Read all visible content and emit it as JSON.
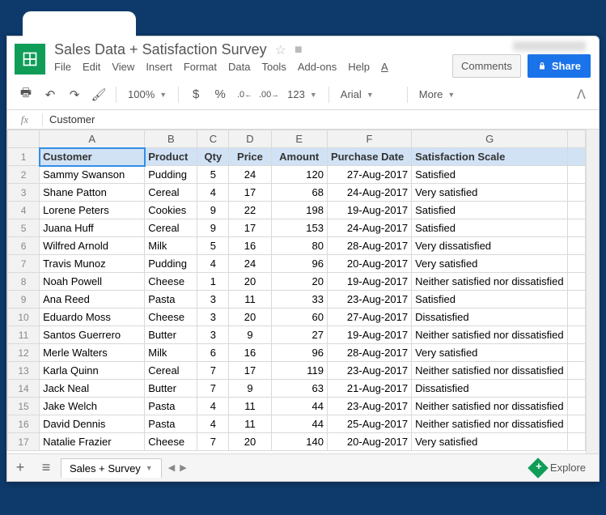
{
  "doc_title": "Sales Data + Satisfaction Survey",
  "menu": {
    "file": "File",
    "edit": "Edit",
    "view": "View",
    "insert": "Insert",
    "format": "Format",
    "data": "Data",
    "tools": "Tools",
    "addons": "Add-ons",
    "help": "Help",
    "last_edit": "A"
  },
  "buttons": {
    "comments": "Comments",
    "share": "Share"
  },
  "toolbar": {
    "zoom": "100%",
    "currency": "$",
    "percent": "%",
    "dec_dec": ".0",
    "dec_inc": ".00",
    "numfmt": "123",
    "font": "Arial",
    "more": "More"
  },
  "formula_bar": {
    "fx": "fx",
    "value": "Customer"
  },
  "columns": [
    "A",
    "B",
    "C",
    "D",
    "E",
    "F",
    "G",
    ""
  ],
  "header_row": {
    "A": "Customer",
    "B": "Product",
    "C": "Qty",
    "D": "Price",
    "E": "Amount",
    "F": "Purchase Date",
    "G": "Satisfaction Scale"
  },
  "rows": [
    {
      "n": 2,
      "A": "Sammy Swanson",
      "B": "Pudding",
      "C": 5,
      "D": 24,
      "E": 120,
      "F": "27-Aug-2017",
      "G": "Satisfied"
    },
    {
      "n": 3,
      "A": "Shane Patton",
      "B": "Cereal",
      "C": 4,
      "D": 17,
      "E": 68,
      "F": "24-Aug-2017",
      "G": "Very satisfied"
    },
    {
      "n": 4,
      "A": "Lorene Peters",
      "B": "Cookies",
      "C": 9,
      "D": 22,
      "E": 198,
      "F": "19-Aug-2017",
      "G": "Satisfied"
    },
    {
      "n": 5,
      "A": "Juana Huff",
      "B": "Cereal",
      "C": 9,
      "D": 17,
      "E": 153,
      "F": "24-Aug-2017",
      "G": "Satisfied"
    },
    {
      "n": 6,
      "A": "Wilfred Arnold",
      "B": "Milk",
      "C": 5,
      "D": 16,
      "E": 80,
      "F": "28-Aug-2017",
      "G": "Very dissatisfied"
    },
    {
      "n": 7,
      "A": "Travis Munoz",
      "B": "Pudding",
      "C": 4,
      "D": 24,
      "E": 96,
      "F": "20-Aug-2017",
      "G": "Very satisfied"
    },
    {
      "n": 8,
      "A": "Noah Powell",
      "B": "Cheese",
      "C": 1,
      "D": 20,
      "E": 20,
      "F": "19-Aug-2017",
      "G": "Neither satisfied nor dissatisfied"
    },
    {
      "n": 9,
      "A": "Ana Reed",
      "B": "Pasta",
      "C": 3,
      "D": 11,
      "E": 33,
      "F": "23-Aug-2017",
      "G": "Satisfied"
    },
    {
      "n": 10,
      "A": "Eduardo Moss",
      "B": "Cheese",
      "C": 3,
      "D": 20,
      "E": 60,
      "F": "27-Aug-2017",
      "G": "Dissatisfied"
    },
    {
      "n": 11,
      "A": "Santos Guerrero",
      "B": "Butter",
      "C": 3,
      "D": 9,
      "E": 27,
      "F": "19-Aug-2017",
      "G": "Neither satisfied nor dissatisfied"
    },
    {
      "n": 12,
      "A": "Merle Walters",
      "B": "Milk",
      "C": 6,
      "D": 16,
      "E": 96,
      "F": "28-Aug-2017",
      "G": "Very satisfied"
    },
    {
      "n": 13,
      "A": "Karla Quinn",
      "B": "Cereal",
      "C": 7,
      "D": 17,
      "E": 119,
      "F": "23-Aug-2017",
      "G": "Neither satisfied nor dissatisfied"
    },
    {
      "n": 14,
      "A": "Jack Neal",
      "B": "Butter",
      "C": 7,
      "D": 9,
      "E": 63,
      "F": "21-Aug-2017",
      "G": "Dissatisfied"
    },
    {
      "n": 15,
      "A": "Jake Welch",
      "B": "Pasta",
      "C": 4,
      "D": 11,
      "E": 44,
      "F": "23-Aug-2017",
      "G": "Neither satisfied nor dissatisfied"
    },
    {
      "n": 16,
      "A": "David Dennis",
      "B": "Pasta",
      "C": 4,
      "D": 11,
      "E": 44,
      "F": "25-Aug-2017",
      "G": "Neither satisfied nor dissatisfied"
    },
    {
      "n": 17,
      "A": "Natalie Frazier",
      "B": "Cheese",
      "C": 7,
      "D": 20,
      "E": 140,
      "F": "20-Aug-2017",
      "G": "Very satisfied"
    }
  ],
  "sheet_tab": "Sales + Survey",
  "explore": "Explore"
}
